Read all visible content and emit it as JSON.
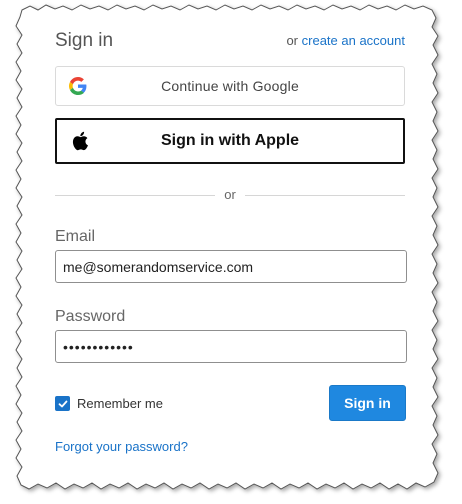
{
  "header": {
    "title": "Sign in",
    "or_text": "or",
    "create_account_link": "create an account"
  },
  "social": {
    "google_label": "Continue with Google",
    "apple_label": "Sign in with Apple"
  },
  "divider_text": "or",
  "form": {
    "email_label": "Email",
    "email_value": "me@somerandomservice.com",
    "password_label": "Password",
    "password_value": "••••••••••••",
    "remember_label": "Remember me",
    "remember_checked": true,
    "signin_label": "Sign in",
    "forgot_link": "Forgot your password?"
  },
  "colors": {
    "link": "#1a73c8",
    "primary_button": "#1f88e0",
    "google_blue": "#4285F4",
    "google_red": "#EA4335",
    "google_yellow": "#FBBC05",
    "google_green": "#34A853"
  },
  "icons": [
    "google-icon",
    "apple-icon",
    "checkmark-icon"
  ]
}
